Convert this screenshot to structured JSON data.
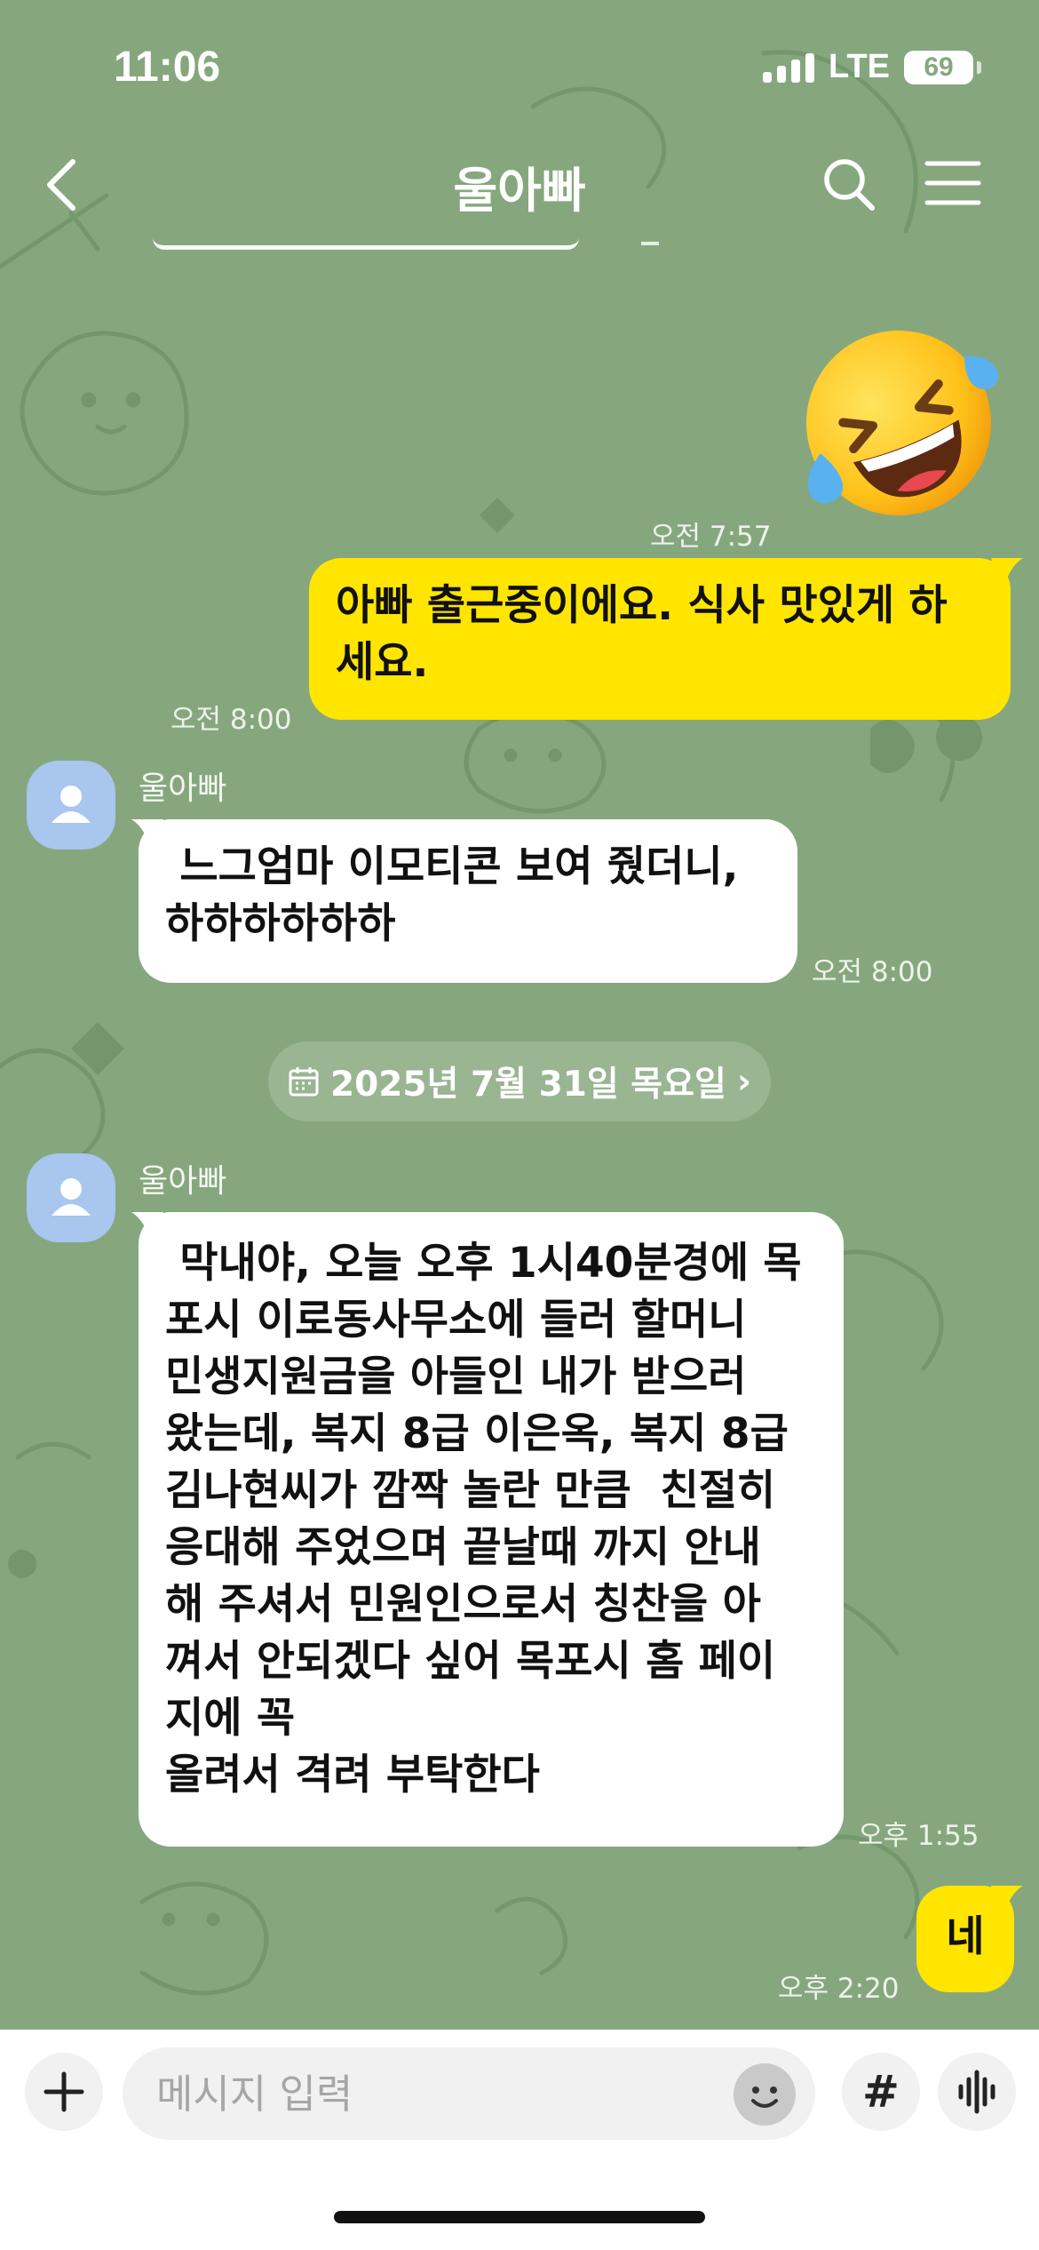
{
  "status_bar": {
    "time": "11:06",
    "network": "LTE",
    "battery": "69"
  },
  "header": {
    "title": "울아빠",
    "back_icon": "chevron-left-icon",
    "search_icon": "search-icon",
    "menu_icon": "hamburger-menu-icon"
  },
  "messages": [
    {
      "type": "emoticon",
      "sender": "me",
      "emoji": "🤣",
      "time": "오전 7:57"
    },
    {
      "type": "text",
      "sender": "me",
      "text": "아빠 출근중이에요. 식사 맛있게 하\n세요.",
      "time": "오전 8:00"
    },
    {
      "type": "text",
      "sender": "울아빠",
      "text": " 느그엄마 이모티콘 보여 줬더니,\n하하하하하하",
      "time": "오전 8:00"
    },
    {
      "type": "date",
      "text": "2025년 7월 31일 목요일",
      "icon": "calendar-icon",
      "chevron": "›"
    },
    {
      "type": "text",
      "sender": "울아빠",
      "text": " 막내야, 오늘 오후 1시40분경에 목\n포시 이로동사무소에 들러 할머니\n민생지원금을 아들인 내가 받으러\n왔는데, 복지 8급 이은옥, 복지 8급\n김나현씨가 깜짝 놀란 만큼  친절히\n응대해 주었으며 끝날때 까지 안내\n해 주셔서 민원인으로서 칭찬을 아\n껴서 안되겠다 싶어 목포시 홈 페이\n지에 꼭\n올려서 격려 부탁한다",
      "time": "오후 1:55"
    },
    {
      "type": "text",
      "sender": "me",
      "text": "네",
      "time": "오후 2:20"
    }
  ],
  "input": {
    "placeholder": "메시지 입력",
    "plus_icon": "plus-icon",
    "emoji_icon": "smiley-icon",
    "hash_label": "#",
    "voice_icon": "voice-wave-icon"
  },
  "colors": {
    "background": "#86a77e",
    "my_bubble": "#ffe500",
    "their_bubble": "#ffffff",
    "avatar": "#a8c6ee"
  }
}
